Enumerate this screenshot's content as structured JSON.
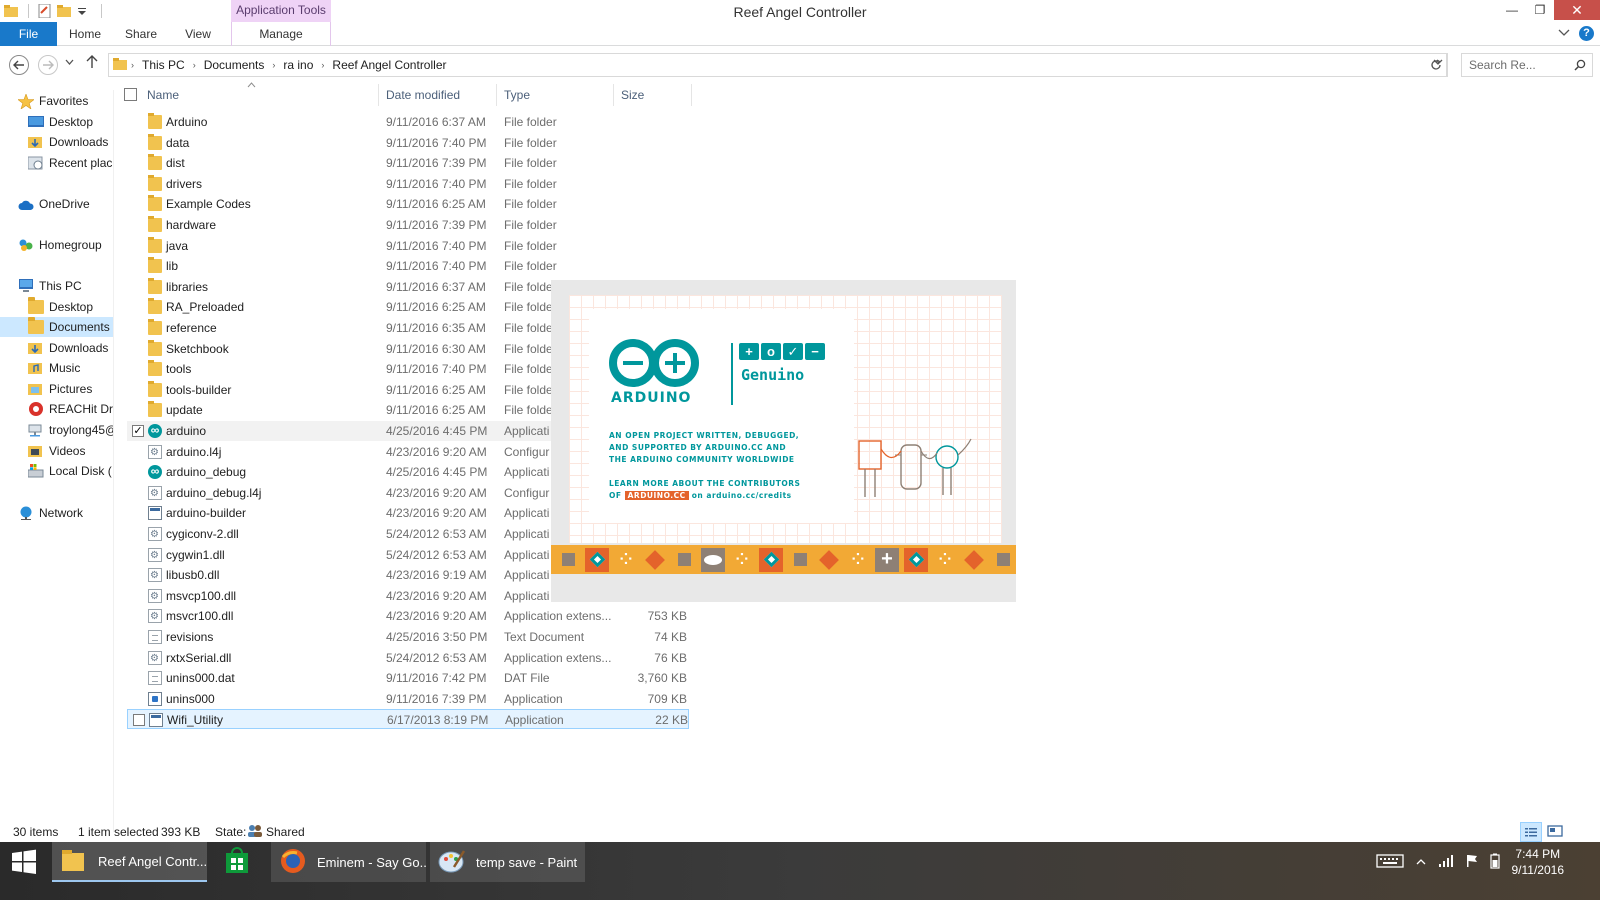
{
  "window": {
    "title": "Reef Angel Controller",
    "app_tools_label": "Application Tools",
    "minimize": "—",
    "restore": "❐",
    "close": "✕"
  },
  "ribbon": {
    "file": "File",
    "home": "Home",
    "share": "Share",
    "view": "View",
    "manage": "Manage",
    "help": "?"
  },
  "address": {
    "crumbs": [
      "This PC",
      "Documents",
      "ra ino",
      "Reef Angel Controller"
    ],
    "search_placeholder": "Search Re..."
  },
  "navpane": {
    "favorites": "Favorites",
    "fav_desktop": "Desktop",
    "fav_downloads": "Downloads",
    "fav_recent": "Recent plac",
    "onedrive": "OneDrive",
    "homegroup": "Homegroup",
    "thispc": "This PC",
    "pc_desktop": "Desktop",
    "pc_documents": "Documents",
    "pc_downloads": "Downloads",
    "pc_music": "Music",
    "pc_pictures": "Pictures",
    "pc_reachit": "REACHit Dri",
    "pc_troy": "troylong45@",
    "pc_videos": "Videos",
    "pc_localdisk": "Local Disk (",
    "network": "Network"
  },
  "columns": {
    "name": "Name",
    "date": "Date modified",
    "type": "Type",
    "size": "Size"
  },
  "files": [
    {
      "name": "Arduino",
      "date": "9/11/2016 6:37 AM",
      "type": "File folder",
      "size": "",
      "icon": "folder"
    },
    {
      "name": "data",
      "date": "9/11/2016 7:40 PM",
      "type": "File folder",
      "size": "",
      "icon": "folder"
    },
    {
      "name": "dist",
      "date": "9/11/2016 7:39 PM",
      "type": "File folder",
      "size": "",
      "icon": "folder"
    },
    {
      "name": "drivers",
      "date": "9/11/2016 7:40 PM",
      "type": "File folder",
      "size": "",
      "icon": "folder"
    },
    {
      "name": "Example Codes",
      "date": "9/11/2016 6:25 AM",
      "type": "File folder",
      "size": "",
      "icon": "folder"
    },
    {
      "name": "hardware",
      "date": "9/11/2016 7:39 PM",
      "type": "File folder",
      "size": "",
      "icon": "folder"
    },
    {
      "name": "java",
      "date": "9/11/2016 7:40 PM",
      "type": "File folder",
      "size": "",
      "icon": "folder"
    },
    {
      "name": "lib",
      "date": "9/11/2016 7:40 PM",
      "type": "File folder",
      "size": "",
      "icon": "folder"
    },
    {
      "name": "libraries",
      "date": "9/11/2016 6:37 AM",
      "type": "File folde",
      "size": "",
      "icon": "folder"
    },
    {
      "name": "RA_Preloaded",
      "date": "9/11/2016 6:25 AM",
      "type": "File folde",
      "size": "",
      "icon": "folder"
    },
    {
      "name": "reference",
      "date": "9/11/2016 6:35 AM",
      "type": "File folde",
      "size": "",
      "icon": "folder"
    },
    {
      "name": "Sketchbook",
      "date": "9/11/2016 6:30 AM",
      "type": "File folde",
      "size": "",
      "icon": "folder"
    },
    {
      "name": "tools",
      "date": "9/11/2016 7:40 PM",
      "type": "File folde",
      "size": "",
      "icon": "folder"
    },
    {
      "name": "tools-builder",
      "date": "9/11/2016 6:25 AM",
      "type": "File folde",
      "size": "",
      "icon": "folder"
    },
    {
      "name": "update",
      "date": "9/11/2016 6:25 AM",
      "type": "File folde",
      "size": "",
      "icon": "folder"
    },
    {
      "name": "arduino",
      "date": "4/25/2016 4:45 PM",
      "type": "Applicati",
      "size": "",
      "icon": "arduino"
    },
    {
      "name": "arduino.l4j",
      "date": "4/23/2016 9:20 AM",
      "type": "Configur",
      "size": "",
      "icon": "gear"
    },
    {
      "name": "arduino_debug",
      "date": "4/25/2016 4:45 PM",
      "type": "Applicati",
      "size": "",
      "icon": "arduino"
    },
    {
      "name": "arduino_debug.l4j",
      "date": "4/23/2016 9:20 AM",
      "type": "Configur",
      "size": "",
      "icon": "gear"
    },
    {
      "name": "arduino-builder",
      "date": "4/23/2016 9:20 AM",
      "type": "Applicati",
      "size": "",
      "icon": "app"
    },
    {
      "name": "cygiconv-2.dll",
      "date": "5/24/2012 6:53 AM",
      "type": "Applicati",
      "size": "",
      "icon": "gear"
    },
    {
      "name": "cygwin1.dll",
      "date": "5/24/2012 6:53 AM",
      "type": "Applicati",
      "size": "",
      "icon": "gear"
    },
    {
      "name": "libusb0.dll",
      "date": "4/23/2016 9:19 AM",
      "type": "Applicati",
      "size": "",
      "icon": "gear"
    },
    {
      "name": "msvcp100.dll",
      "date": "4/23/2016 9:20 AM",
      "type": "Applicati",
      "size": "",
      "icon": "gear"
    },
    {
      "name": "msvcr100.dll",
      "date": "4/23/2016 9:20 AM",
      "type": "Application extens...",
      "size": "753 KB",
      "icon": "gear"
    },
    {
      "name": "revisions",
      "date": "4/25/2016 3:50 PM",
      "type": "Text Document",
      "size": "74 KB",
      "icon": "doc"
    },
    {
      "name": "rxtxSerial.dll",
      "date": "5/24/2012 6:53 AM",
      "type": "Application extens...",
      "size": "76 KB",
      "icon": "gear"
    },
    {
      "name": "unins000.dat",
      "date": "9/11/2016 7:42 PM",
      "type": "DAT File",
      "size": "3,760 KB",
      "icon": "doc"
    },
    {
      "name": "unins000",
      "date": "9/11/2016 7:39 PM",
      "type": "Application",
      "size": "709 KB",
      "icon": "installer"
    },
    {
      "name": "Wifi_Utility",
      "date": "6/17/2013 8:19 PM",
      "type": "Application",
      "size": "22 KB",
      "icon": "app"
    }
  ],
  "splash": {
    "brand_arduino": "ARDUINO",
    "brand_genuino": "Genuino",
    "tag1": "AN OPEN PROJECT WRITTEN, DEBUGGED,",
    "tag2": "AND SUPPORTED BY ARDUINO.CC AND",
    "tag3": "THE ARDUINO COMMUNITY WORLDWIDE",
    "learn1": "LEARN MORE ABOUT THE CONTRIBUTORS",
    "learn2_prefix": "OF",
    "learn2_badge": "ARDUINO.CC",
    "learn2_suffix": "on arduino.cc/credits"
  },
  "status": {
    "items": "30 items",
    "selected": "1 item selected",
    "selected_size": "393 KB",
    "state_label": "State:",
    "state_value": "Shared"
  },
  "taskbar": {
    "explorer": "Reef Angel Contr...",
    "firefox": "Eminem - Say Go...",
    "paint": "temp save - Paint",
    "time": "7:44 PM",
    "date": "9/11/2016"
  },
  "colors": {
    "accent": "#1979ca",
    "arduino_teal": "#00979c",
    "arduino_orange": "#e4632b",
    "arduino_yellow": "#f2a935"
  }
}
